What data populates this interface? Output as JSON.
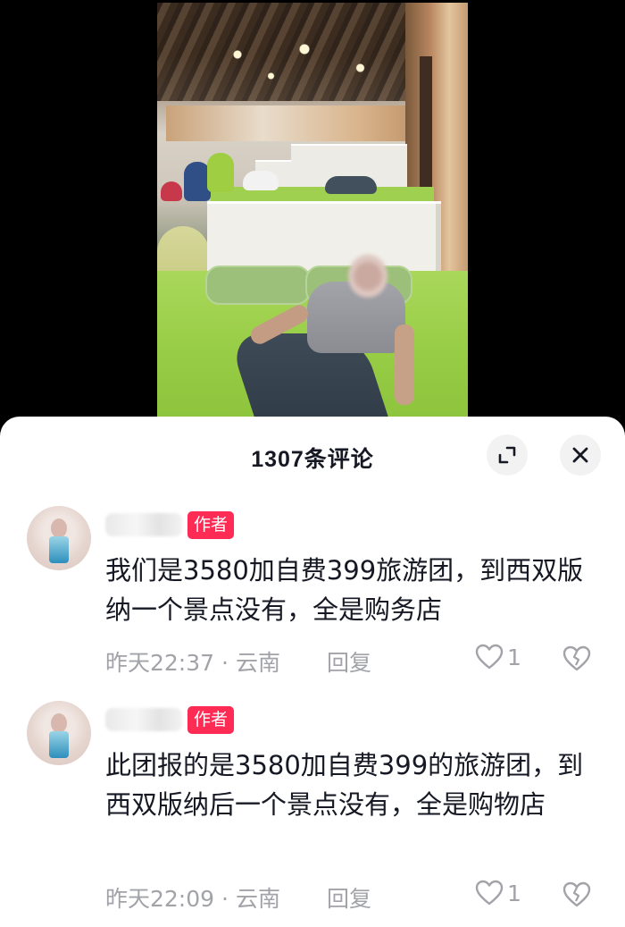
{
  "sheet": {
    "title": "1307条评论",
    "expand_icon": "expand-icon",
    "close_icon": "close-icon"
  },
  "comments": [
    {
      "badge": "作者",
      "text": "我们是3580加自费399旅游团，到西双版纳一个景点没有，全是购务店",
      "time": "昨天22:37",
      "location": "云南",
      "reply": "回复",
      "likes": "1",
      "icons": {
        "like": "heart-icon",
        "dislike": "broken-heart-icon"
      }
    },
    {
      "badge": "作者",
      "text": "此团报的是3580加自费399的旅游团，到西双版纳后一个景点没有，全是购物店",
      "time": "昨天22:09",
      "location": "云南",
      "reply": "回复",
      "likes": "1",
      "icons": {
        "like": "heart-icon",
        "dislike": "broken-heart-icon"
      }
    }
  ],
  "colors": {
    "badge": "#fe2c55",
    "meta_text": "#a2a3a8",
    "primary_text": "#161823",
    "button_bg": "#f2f2f2"
  }
}
